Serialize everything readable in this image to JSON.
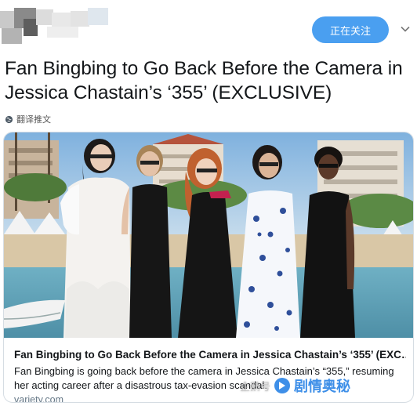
{
  "header": {
    "follow_label": "正在关注",
    "avatar_icon": "blurred-avatar",
    "more_icon": "chevron-down-icon"
  },
  "tweet": {
    "text": "Fan Bingbing to Go Back Before the Camera in Jessica Chastain’s ‘355’ (EXCLUSIVE)",
    "translate_label": "翻译推文",
    "translate_icon": "globe-icon"
  },
  "card": {
    "title": "Fan Bingbing to Go Back Before the Camera in Jessica Chastain’s ‘355’ (EXC…",
    "description": "Fan Bingbing is going back before the camera in Jessica Chastain’s “355,” resuming her acting career after a disastrous tax-evasion scandal.",
    "domain": "variety.com"
  },
  "watermark": {
    "prefix": "企鹅号",
    "brand": "剧情奥秘"
  },
  "colors": {
    "follow_button": "#4a9ff0",
    "domain_text": "#657786",
    "border": "#d6dde3"
  }
}
